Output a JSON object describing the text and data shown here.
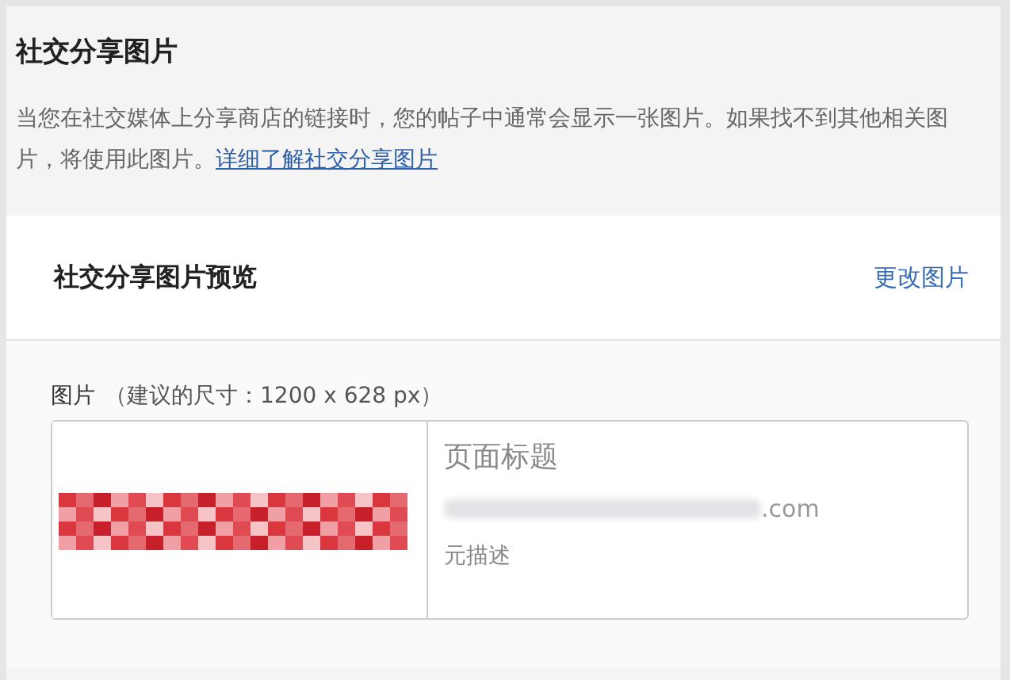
{
  "section": {
    "title": "社交分享图片",
    "description": "当您在社交媒体上分享商店的链接时，您的帖子中通常会显示一张图片。如果找不到其他相关图片，将使用此图片。",
    "link": "详细了解社交分享图片"
  },
  "card": {
    "title": "社交分享图片预览",
    "action": "更改图片",
    "field_label": "图片",
    "field_hint": "（建议的尺寸：1200 x 628 px）",
    "preview": {
      "page_title": "页面标题",
      "url": ".com",
      "meta_description": "元描述"
    }
  }
}
